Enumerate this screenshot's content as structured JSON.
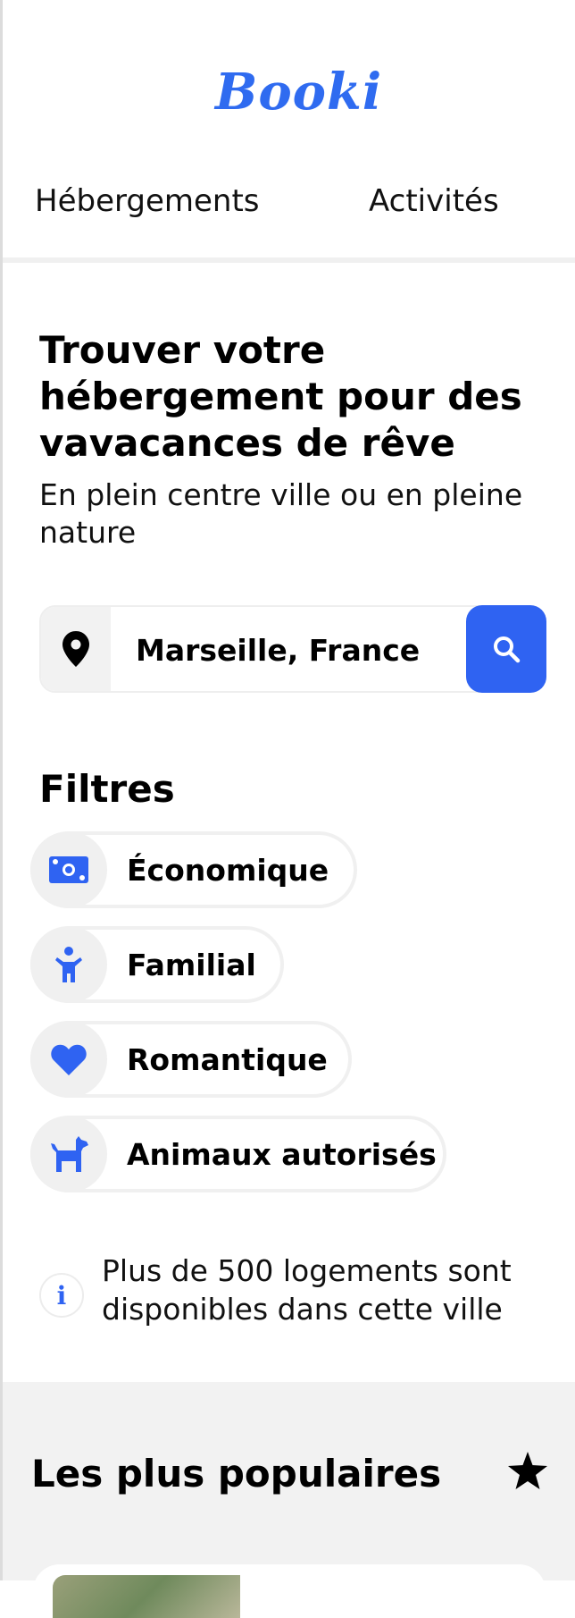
{
  "header": {
    "logo": "Booki",
    "nav": [
      "Hébergements",
      "Activités"
    ]
  },
  "hero": {
    "title": "Trouver votre hébergement pour des vavacances de rêve",
    "subtitle": "En plein centre ville ou en pleine nature"
  },
  "search": {
    "value": "Marseille, France",
    "pin_icon": "location-pin-icon",
    "button_icon": "search-icon"
  },
  "filters": {
    "title": "Filtres",
    "items": [
      {
        "label": "Économique",
        "icon": "money-icon"
      },
      {
        "label": "Familial",
        "icon": "child-icon"
      },
      {
        "label": "Romantique",
        "icon": "heart-icon"
      },
      {
        "label": "Animaux autorisés",
        "icon": "dog-icon"
      }
    ]
  },
  "info": {
    "text": "Plus de 500 logements sont disponibles dans cette ville",
    "icon": "info-icon"
  },
  "popular": {
    "title": "Les plus populaires",
    "icon": "star-icon"
  },
  "colors": {
    "accent": "#2f63f2",
    "light_gray": "#f2f2f2"
  }
}
